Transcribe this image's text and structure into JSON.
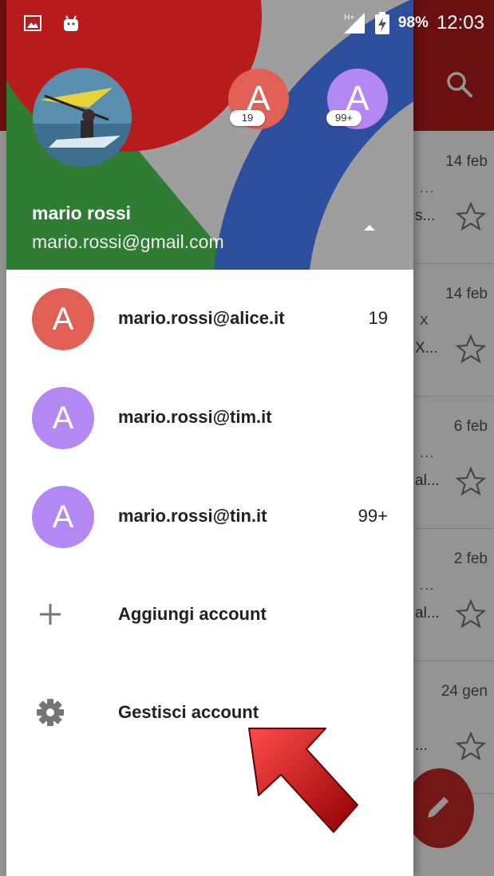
{
  "status_bar": {
    "battery_percent": "98%",
    "time": "12:03",
    "left_icons": [
      "image-icon",
      "android-icon"
    ],
    "right_icons": [
      "signal-icon",
      "battery-charging-icon"
    ]
  },
  "drawer": {
    "header": {
      "name": "mario rossi",
      "email": "mario.rossi@gmail.com",
      "mini_accounts": [
        {
          "initial": "A",
          "badge": "19",
          "color": "#e06055"
        },
        {
          "initial": "A",
          "badge": "99+",
          "color": "#b388f5"
        }
      ],
      "colors": {
        "red": "#b71c1c",
        "green": "#2e7d32",
        "blue": "#2d4f9e",
        "gray": "#9e9e9e"
      }
    },
    "accounts": [
      {
        "initial": "A",
        "email": "mario.rossi@alice.it",
        "count": "19",
        "color": "#e06055"
      },
      {
        "initial": "A",
        "email": "mario.rossi@tim.it",
        "count": "",
        "color": "#b388f5"
      },
      {
        "initial": "A",
        "email": "mario.rossi@tin.it",
        "count": "99+",
        "color": "#b388f5"
      }
    ],
    "actions": [
      {
        "icon": "plus-icon",
        "label": "Aggiungi account"
      },
      {
        "icon": "gear-icon",
        "label": "Gestisci account"
      }
    ]
  },
  "inbox_background": {
    "dates": [
      "14 feb",
      "14 feb",
      "6 feb",
      "2 feb",
      "24 gen"
    ],
    "snippets": [
      "s...",
      "X...",
      "al...",
      "al...",
      "..."
    ]
  },
  "colors": {
    "accent_red": "#b71c1c",
    "fab_red": "#c62828",
    "arrow_red": "#cc0000"
  }
}
